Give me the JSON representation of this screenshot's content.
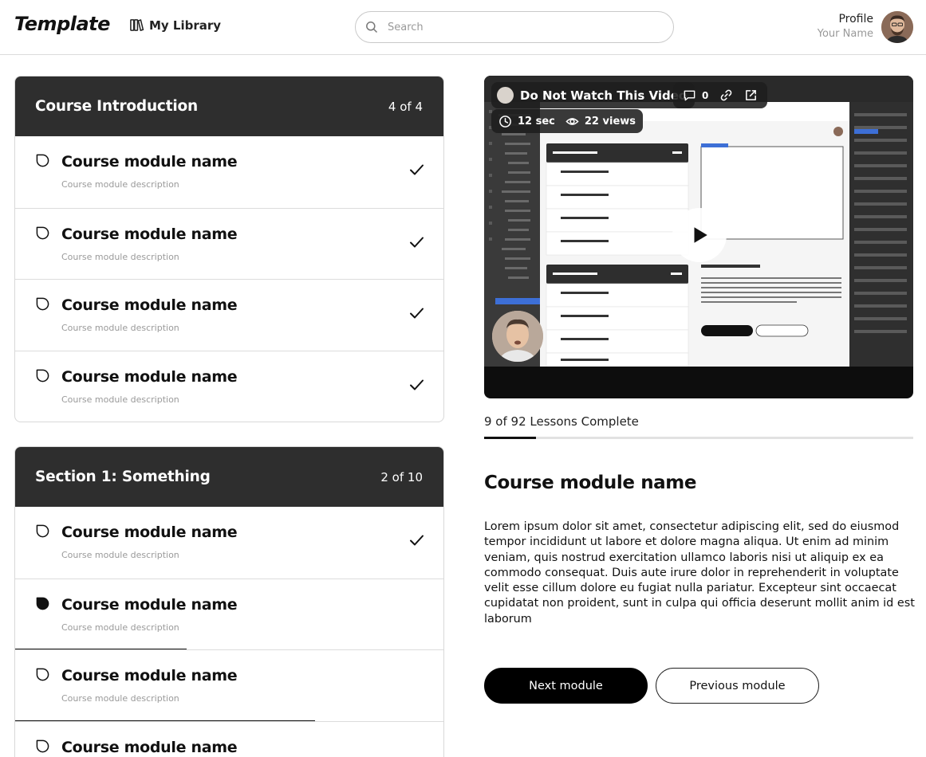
{
  "header": {
    "logo": "Template",
    "library_label": "My Library",
    "search_placeholder": "Search",
    "profile_label": "Profile",
    "profile_name": "Your Name"
  },
  "sections": [
    {
      "title": "Course Introduction",
      "count": "4 of 4",
      "modules": [
        {
          "name": "Course module name",
          "description": "Course module description",
          "completed": true,
          "active": false,
          "progress": 0
        },
        {
          "name": "Course module name",
          "description": "Course module description",
          "completed": true,
          "active": false,
          "progress": 0
        },
        {
          "name": "Course module name",
          "description": "Course module description",
          "completed": true,
          "active": false,
          "progress": 0
        },
        {
          "name": "Course module name",
          "description": "Course module description",
          "completed": true,
          "active": false,
          "progress": 0
        }
      ]
    },
    {
      "title": "Section 1: Something",
      "count": "2 of 10",
      "modules": [
        {
          "name": "Course module name",
          "description": "Course module description",
          "completed": true,
          "active": false,
          "progress": 0
        },
        {
          "name": "Course module name",
          "description": "Course module description",
          "completed": false,
          "active": true,
          "progress": 0.4
        },
        {
          "name": "Course module name",
          "description": "Course module description",
          "completed": false,
          "active": false,
          "progress": 0.7
        },
        {
          "name": "Course module name",
          "description": "",
          "completed": false,
          "active": false,
          "progress": 0
        }
      ]
    }
  ],
  "video": {
    "title": "Do Not Watch This Video",
    "comments": "0",
    "duration": "12 sec",
    "views": "22 views"
  },
  "lessons": {
    "label": "9 of 92 Lessons Complete",
    "progress": 0.12
  },
  "content": {
    "title": "Course module name",
    "body": "Lorem ipsum dolor sit amet, consectetur adipiscing elit, sed do eiusmod tempor incididunt ut labore et dolore magna aliqua. Ut enim ad minim veniam, quis nostrud exercitation ullamco laboris nisi ut aliquip ex ea commodo consequat. Duis aute irure dolor in reprehenderit in voluptate velit esse cillum dolore eu fugiat nulla pariatur. Excepteur sint occaecat cupidatat non proident, sunt in culpa qui officia deserunt mollit anim id est laborum"
  },
  "buttons": {
    "next": "Next module",
    "previous": "Previous module"
  },
  "colors": {
    "header_dark": "#2e2e2e",
    "accent": "#000000",
    "muted": "#9a9a9a"
  }
}
